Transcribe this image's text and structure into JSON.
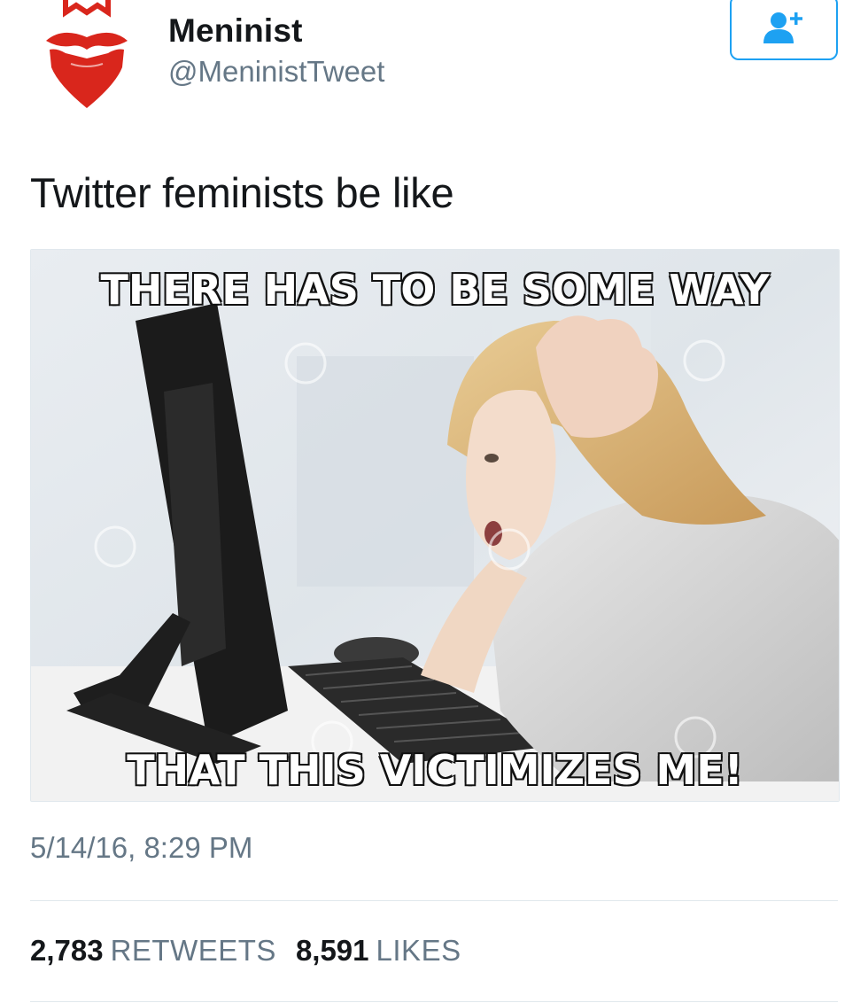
{
  "tweet": {
    "author": {
      "display_name": "Meninist",
      "handle": "@MeninistTweet",
      "avatar_icon": "red-mustache-beard-logo-icon",
      "brand_color": "#d9261c"
    },
    "follow_button": {
      "icon": "add-user-icon",
      "color": "#1da1f2"
    },
    "text": "Twitter feminists be like",
    "media": {
      "top_caption": "THERE HAS TO BE SOME WAY",
      "bottom_caption": "THAT THIS VICTIMIZES ME!"
    },
    "timestamp": "5/14/16, 8:29 PM",
    "stats": {
      "retweets_count": "2,783",
      "retweets_label": "RETWEETS",
      "likes_count": "8,591",
      "likes_label": "LIKES"
    }
  }
}
